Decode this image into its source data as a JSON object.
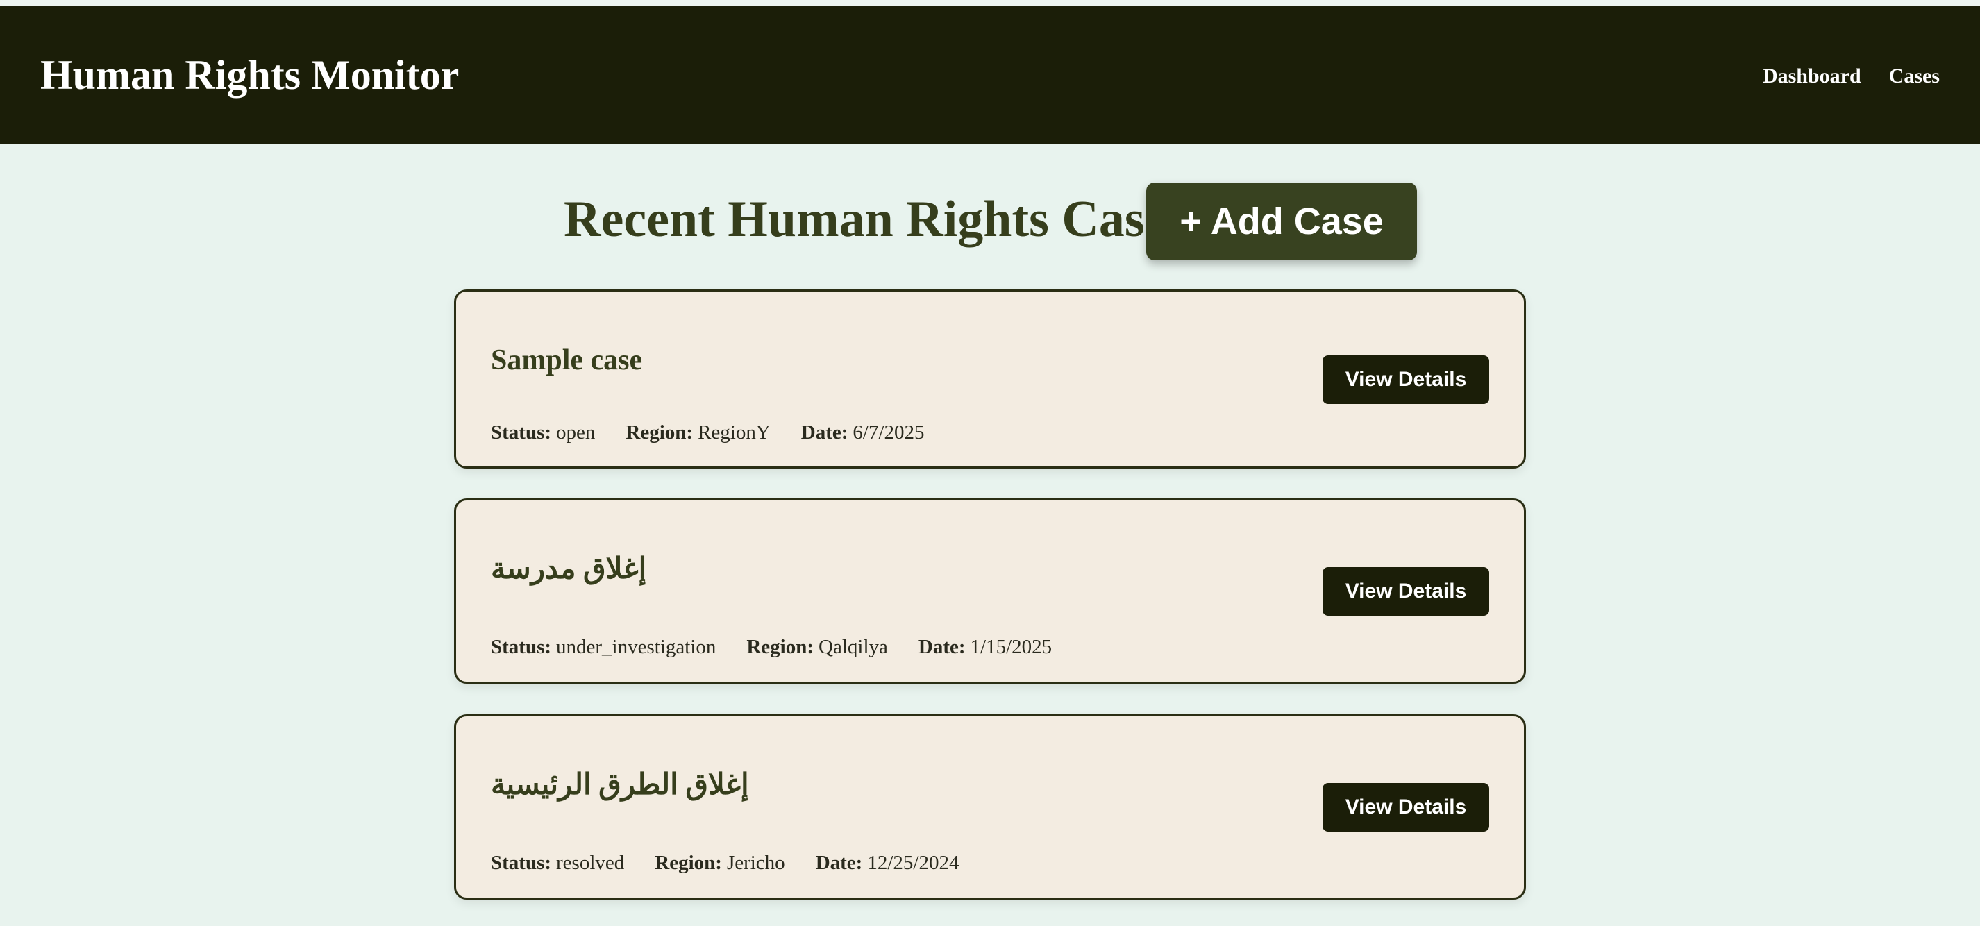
{
  "header": {
    "title": "Human Rights Monitor",
    "nav": [
      {
        "label": "Dashboard"
      },
      {
        "label": "Cases"
      }
    ]
  },
  "main": {
    "title": "Recent Human Rights Cases",
    "add_button_label": "+ Add Case",
    "labels": {
      "status": "Status:",
      "region": "Region:",
      "date": "Date:"
    },
    "cases": [
      {
        "title": "Sample case",
        "status": "open",
        "region": "RegionY",
        "date": "6/7/2025",
        "button": "View Details"
      },
      {
        "title": "إغلاق مدرسة",
        "status": "under_investigation",
        "region": "Qalqilya",
        "date": "1/15/2025",
        "button": "View Details"
      },
      {
        "title": "إغلاق الطرق الرئيسية",
        "status": "resolved",
        "region": "Jericho",
        "date": "12/25/2024",
        "button": "View Details"
      }
    ]
  },
  "colors": {
    "header_bg": "#1b1e08",
    "page_bg": "#e8f3ee",
    "card_bg": "#f3ece1",
    "accent": "#384220",
    "heading_text": "#363e1c"
  }
}
